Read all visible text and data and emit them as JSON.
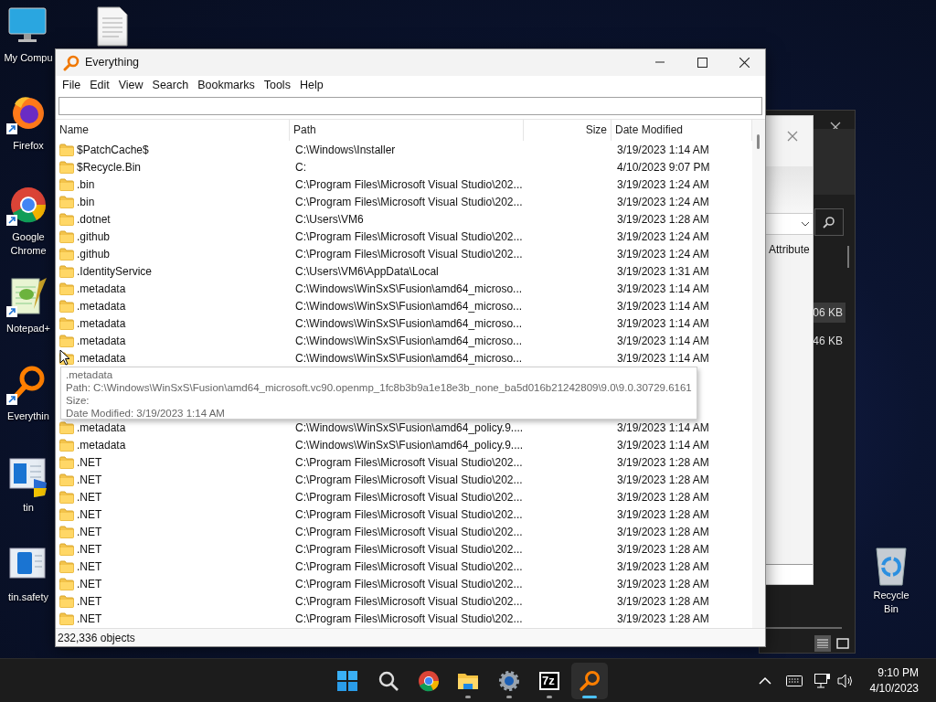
{
  "desktop": {
    "icons": [
      {
        "kind": "computer",
        "label": "My Compu"
      },
      {
        "kind": "firefox",
        "label": "Firefox"
      },
      {
        "kind": "chrome",
        "label": "Google Chrome"
      },
      {
        "kind": "notepad",
        "label": "Notepad+"
      },
      {
        "kind": "everything",
        "label": "Everythin"
      },
      {
        "kind": "installer",
        "label": "tin"
      },
      {
        "kind": "book",
        "label": "tin.safety"
      }
    ],
    "top_icons": [
      {
        "kind": "document"
      }
    ],
    "right_icons": [
      {
        "kind": "recycle",
        "label": "Recycle Bin"
      }
    ]
  },
  "background_window": {
    "column_header": "Attribute",
    "sizes": [
      {
        "text": "06 KB",
        "selected": true
      },
      {
        "text": "46 KB",
        "selected": false
      }
    ]
  },
  "window": {
    "title": "Everything",
    "menu": [
      "File",
      "Edit",
      "View",
      "Search",
      "Bookmarks",
      "Tools",
      "Help"
    ],
    "columns": [
      "Name",
      "Path",
      "Size",
      "Date Modified"
    ],
    "rows": [
      {
        "name": "$PatchCache$",
        "path": "C:\\Windows\\Installer",
        "date_modified": "3/19/2023 1:14 AM"
      },
      {
        "name": "$Recycle.Bin",
        "path": "C:",
        "date_modified": "4/10/2023 9:07 PM"
      },
      {
        "name": ".bin",
        "path": "C:\\Program Files\\Microsoft Visual Studio\\202...",
        "date_modified": "3/19/2023 1:24 AM"
      },
      {
        "name": ".bin",
        "path": "C:\\Program Files\\Microsoft Visual Studio\\202...",
        "date_modified": "3/19/2023 1:24 AM"
      },
      {
        "name": ".dotnet",
        "path": "C:\\Users\\VM6",
        "date_modified": "3/19/2023 1:28 AM"
      },
      {
        "name": ".github",
        "path": "C:\\Program Files\\Microsoft Visual Studio\\202...",
        "date_modified": "3/19/2023 1:24 AM"
      },
      {
        "name": ".github",
        "path": "C:\\Program Files\\Microsoft Visual Studio\\202...",
        "date_modified": "3/19/2023 1:24 AM"
      },
      {
        "name": ".IdentityService",
        "path": "C:\\Users\\VM6\\AppData\\Local",
        "date_modified": "3/19/2023 1:31 AM"
      },
      {
        "name": ".metadata",
        "path": "C:\\Windows\\WinSxS\\Fusion\\amd64_microso...",
        "date_modified": "3/19/2023 1:14 AM"
      },
      {
        "name": ".metadata",
        "path": "C:\\Windows\\WinSxS\\Fusion\\amd64_microso...",
        "date_modified": "3/19/2023 1:14 AM"
      },
      {
        "name": ".metadata",
        "path": "C:\\Windows\\WinSxS\\Fusion\\amd64_microso...",
        "date_modified": "3/19/2023 1:14 AM"
      },
      {
        "name": ".metadata",
        "path": "C:\\Windows\\WinSxS\\Fusion\\amd64_microso...",
        "date_modified": "3/19/2023 1:14 AM"
      },
      {
        "name": ".metadata",
        "path": "C:\\Windows\\WinSxS\\Fusion\\amd64_microso...",
        "date_modified": "3/19/2023 1:14 AM"
      },
      {
        "name": ".metadata",
        "path": "C:\\Windows\\WinSxS\\Fusion\\amd64_policy.9....",
        "date_modified": "3/19/2023 1:14 AM"
      },
      {
        "name": ".metadata",
        "path": "C:\\Windows\\WinSxS\\Fusion\\amd64_policy.9....",
        "date_modified": "3/19/2023 1:14 AM"
      },
      {
        "name": ".NET",
        "path": "C:\\Program Files\\Microsoft Visual Studio\\202...",
        "date_modified": "3/19/2023 1:28 AM"
      },
      {
        "name": ".NET",
        "path": "C:\\Program Files\\Microsoft Visual Studio\\202...",
        "date_modified": "3/19/2023 1:28 AM"
      },
      {
        "name": ".NET",
        "path": "C:\\Program Files\\Microsoft Visual Studio\\202...",
        "date_modified": "3/19/2023 1:28 AM"
      },
      {
        "name": ".NET",
        "path": "C:\\Program Files\\Microsoft Visual Studio\\202...",
        "date_modified": "3/19/2023 1:28 AM"
      },
      {
        "name": ".NET",
        "path": "C:\\Program Files\\Microsoft Visual Studio\\202...",
        "date_modified": "3/19/2023 1:28 AM"
      },
      {
        "name": ".NET",
        "path": "C:\\Program Files\\Microsoft Visual Studio\\202...",
        "date_modified": "3/19/2023 1:28 AM"
      },
      {
        "name": ".NET",
        "path": "C:\\Program Files\\Microsoft Visual Studio\\202...",
        "date_modified": "3/19/2023 1:28 AM"
      },
      {
        "name": ".NET",
        "path": "C:\\Program Files\\Microsoft Visual Studio\\202...",
        "date_modified": "3/19/2023 1:28 AM"
      },
      {
        "name": ".NET",
        "path": "C:\\Program Files\\Microsoft Visual Studio\\202...",
        "date_modified": "3/19/2023 1:28 AM"
      },
      {
        "name": ".NET",
        "path": "C:\\Program Files\\Microsoft Visual Studio\\202...",
        "date_modified": "3/19/2023 1:28 AM"
      }
    ],
    "tooltip": {
      "lines": [
        ".metadata",
        "Path: C:\\Windows\\WinSxS\\Fusion\\amd64_microsoft.vc90.openmp_1fc8b3b9a1e18e3b_none_ba5d016b21242809\\9.0\\9.0.30729.6161",
        "Size:",
        "Date Modified: 3/19/2023 1:14 AM"
      ]
    },
    "status_bar": "232,336 objects"
  },
  "taskbar": {
    "apps": [
      {
        "kind": "start",
        "running": false,
        "active": false
      },
      {
        "kind": "search",
        "running": false,
        "active": false
      },
      {
        "kind": "chrome",
        "running": false,
        "active": false
      },
      {
        "kind": "explorer",
        "running": true,
        "active": false
      },
      {
        "kind": "settings",
        "running": true,
        "active": false
      },
      {
        "kind": "sevenzip",
        "label": "7z",
        "running": true,
        "active": false
      },
      {
        "kind": "everything",
        "running": true,
        "active": true
      }
    ],
    "tray": {
      "time": "9:10 PM",
      "date": "4/10/2023"
    }
  }
}
